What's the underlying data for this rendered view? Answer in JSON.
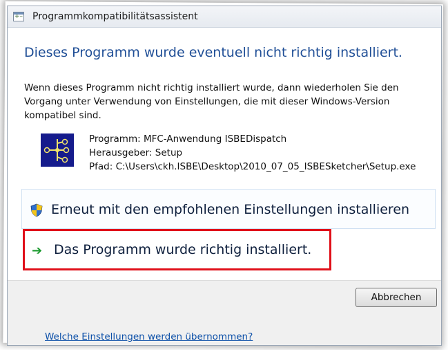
{
  "window": {
    "title": "Programmkompatibilitätsassistent"
  },
  "headline": "Dieses Programm wurde eventuell nicht richtig installiert.",
  "message": "Wenn dieses Programm nicht richtig installiert wurde, dann wiederholen Sie den Vorgang unter Verwendung von Einstellungen, die mit dieser Windows-Version kompatibel sind.",
  "program": {
    "name_line": "Programm: MFC-Anwendung ISBEDispatch",
    "publisher_line": "Herausgeber: Setup",
    "path_line": "Pfad: C:\\Users\\ckh.ISBE\\Desktop\\2010_07_05_ISBESketcher\\Setup.exe"
  },
  "options": {
    "reinstall_label": "Erneut mit den empfohlenen Einstellungen installieren",
    "installed_ok_label": "Das Programm wurde richtig installiert."
  },
  "footer": {
    "cancel_label": "Abbrechen",
    "help_link": "Welche Einstellungen werden übernommen?"
  },
  "icons": {
    "title": "compat-assistant-icon",
    "program": "network-diagram-icon",
    "shield": "uac-shield-icon",
    "arrow": "green-arrow-icon"
  },
  "colors": {
    "headline": "#1f4e96",
    "highlight_border": "#e0101a",
    "arrow": "#1a9a2e",
    "link": "#0b4fa8"
  }
}
